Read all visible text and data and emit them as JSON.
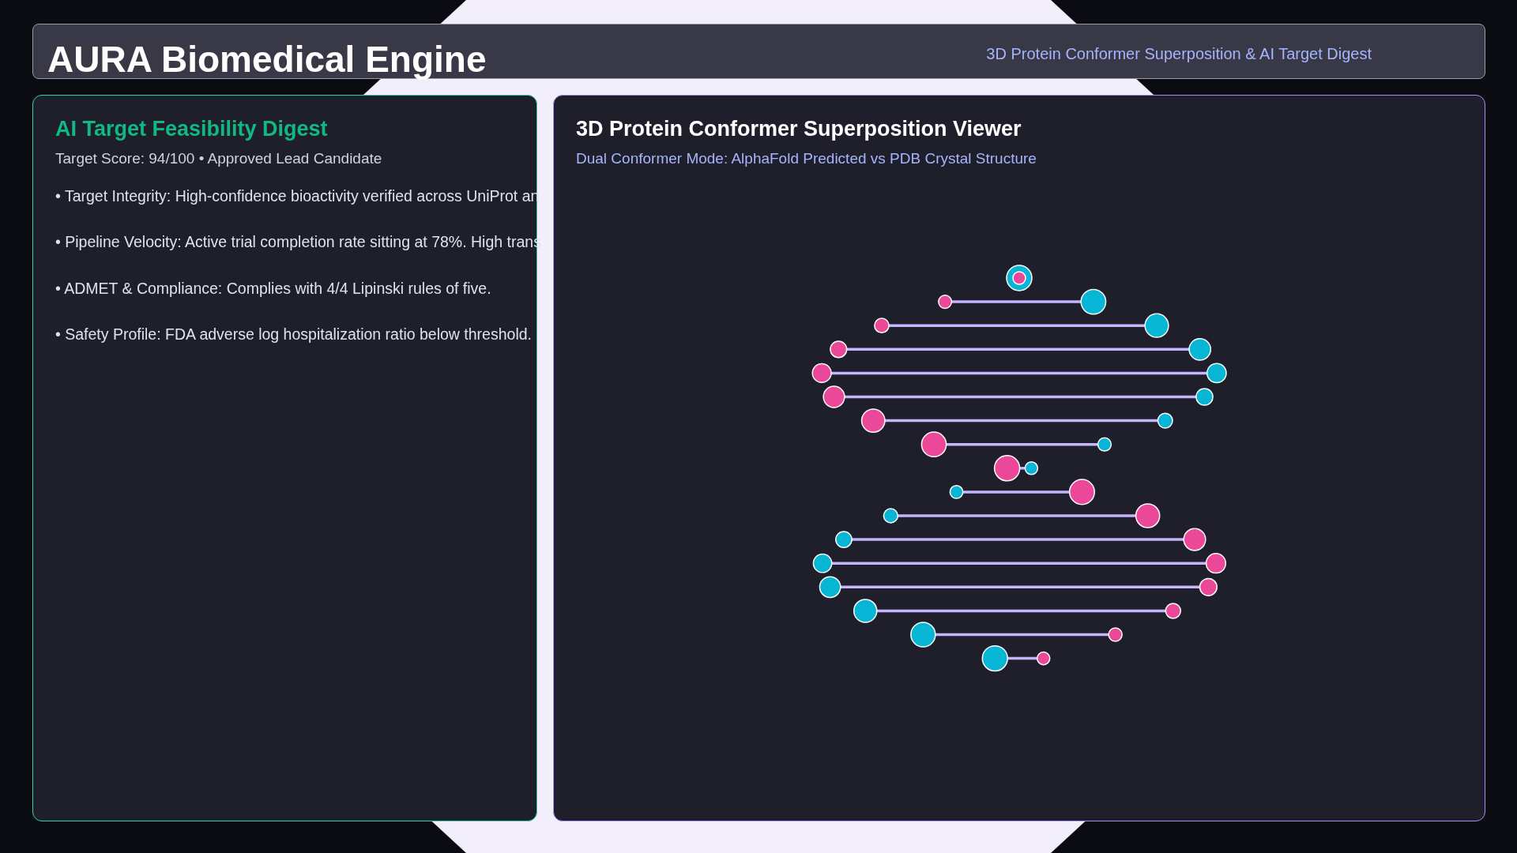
{
  "header": {
    "title": "AURA Biomedical Engine",
    "subtitle": "3D Protein Conformer Superposition & AI Target Digest"
  },
  "digest": {
    "title": "AI Target Feasibility Digest",
    "summary": "Target Score: 94/100 • Approved Lead Candidate",
    "points": [
      "• Target Integrity: High-confidence bioactivity verified across UniProt an",
      "• Pipeline Velocity: Active trial completion rate sitting at 78%. High trans",
      "• ADMET & Compliance: Complies with 4/4 Lipinski rules of five.",
      "• Safety Profile: FDA adverse log hospitalization ratio below threshold."
    ]
  },
  "viewer": {
    "title": "3D Protein Conformer Superposition Viewer",
    "mode": "Dual Conformer Mode: AlphaFold Predicted vs PDB Crystal Structure"
  }
}
